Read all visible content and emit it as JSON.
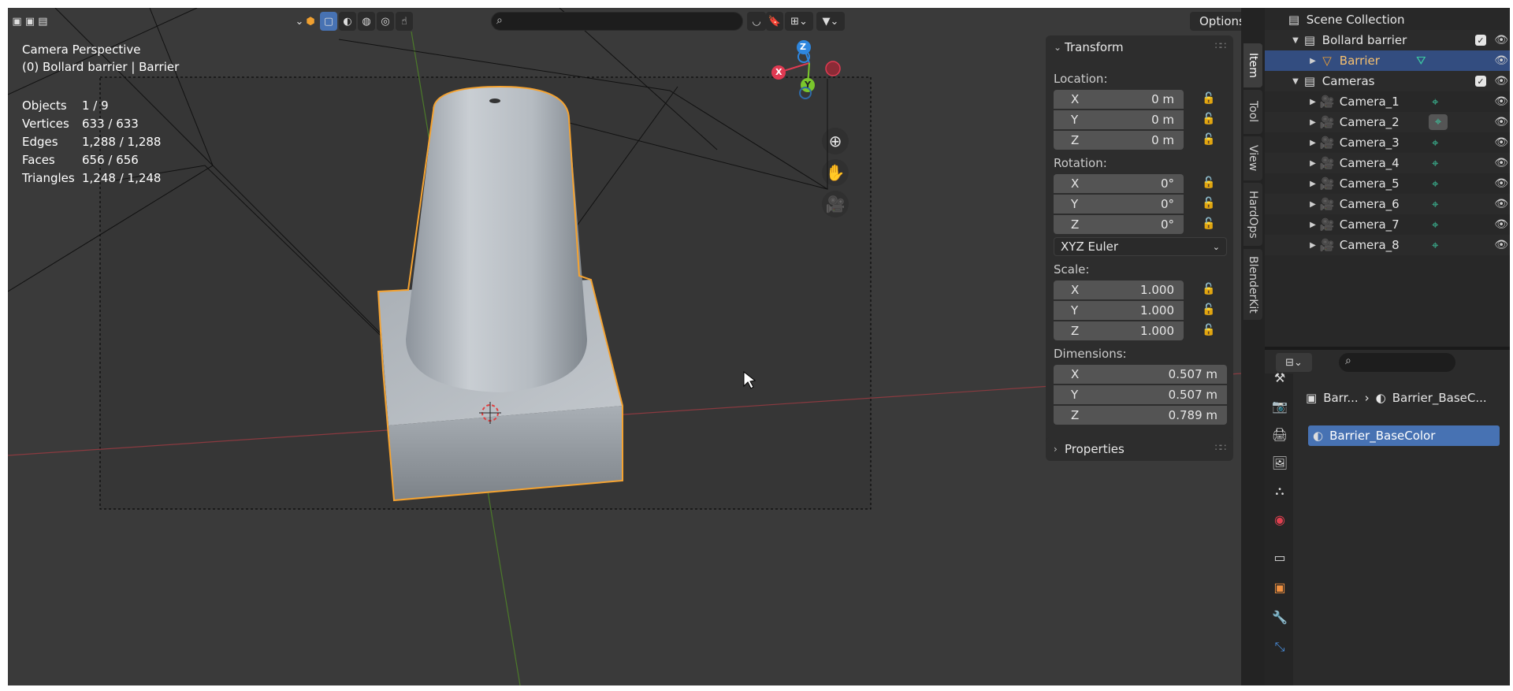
{
  "viewport": {
    "title": "Camera Perspective",
    "subtitle": "(0) Bollard barrier | Barrier",
    "stats": [
      {
        "label": "Objects",
        "value": "1 / 9"
      },
      {
        "label": "Vertices",
        "value": "633 / 633"
      },
      {
        "label": "Edges",
        "value": "1,288 / 1,288"
      },
      {
        "label": "Faces",
        "value": "656 / 656"
      },
      {
        "label": "Triangles",
        "value": "1,248 / 1,248"
      }
    ],
    "options_label": "Options",
    "gizmo": {
      "x": "X",
      "y": "Y",
      "z": "Z"
    }
  },
  "transform": {
    "title": "Transform",
    "location_label": "Location:",
    "location": {
      "x": "0 m",
      "y": "0 m",
      "z": "0 m"
    },
    "rotation_label": "Rotation:",
    "rotation": {
      "x": "0°",
      "y": "0°",
      "z": "0°"
    },
    "rotation_mode": "XYZ Euler",
    "scale_label": "Scale:",
    "scale": {
      "x": "1.000",
      "y": "1.000",
      "z": "1.000"
    },
    "dimensions_label": "Dimensions:",
    "dimensions": {
      "x": "0.507 m",
      "y": "0.507 m",
      "z": "0.789 m"
    },
    "axis": {
      "x": "X",
      "y": "Y",
      "z": "Z"
    }
  },
  "properties_panel_title": "Properties",
  "side_tabs": [
    "Item",
    "Tool",
    "View",
    "HardOps",
    "BlenderKit"
  ],
  "outliner": {
    "root": "Scene Collection",
    "items": [
      {
        "label": "Bollard barrier"
      },
      {
        "label": "Barrier"
      },
      {
        "label": "Cameras"
      },
      {
        "label": "Camera_1"
      },
      {
        "label": "Camera_2"
      },
      {
        "label": "Camera_3"
      },
      {
        "label": "Camera_4"
      },
      {
        "label": "Camera_5"
      },
      {
        "label": "Camera_6"
      },
      {
        "label": "Camera_7"
      },
      {
        "label": "Camera_8"
      }
    ]
  },
  "properties": {
    "breadcrumb_object": "Barr...",
    "breadcrumb_material": "Barrier_BaseC...",
    "material_slot": "Barrier_BaseColor"
  },
  "colors": {
    "accent": "#4772b3",
    "selection_outline": "#f5a331",
    "axis_x": "#e03a52",
    "axis_y": "#7ac62c",
    "axis_z": "#2e86de"
  }
}
